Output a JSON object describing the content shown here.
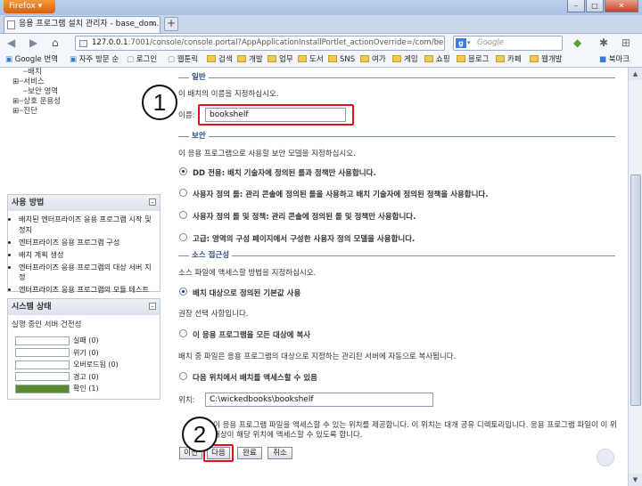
{
  "browser": {
    "app_button": "Firefox",
    "tab_title": "응용 프로그램 설치 관리자 - base_dom...",
    "tab_close": "×",
    "new_tab": "+",
    "url_prefix": "127.0.0.1",
    "url_rest": ":7001/console/console.portal?AppApplicationInstallPortlet_actionOverride=/com/bea",
    "search_placeholder": "Google",
    "window_buttons": [
      "–",
      "□",
      "✕"
    ]
  },
  "bookmarks": [
    {
      "label": "Google 번역",
      "type": "link"
    },
    {
      "label": "자주 방문 순",
      "type": "link"
    },
    {
      "label": "로그인",
      "type": "link"
    },
    {
      "label": "웹툰릭",
      "type": "link"
    },
    {
      "label": "검색",
      "type": "folder"
    },
    {
      "label": "개발",
      "type": "folder"
    },
    {
      "label": "업무",
      "type": "folder"
    },
    {
      "label": "도서",
      "type": "folder"
    },
    {
      "label": "SNS",
      "type": "folder"
    },
    {
      "label": "여가",
      "type": "folder"
    },
    {
      "label": "게임",
      "type": "folder"
    },
    {
      "label": "쇼핑",
      "type": "folder"
    },
    {
      "label": "블로그",
      "type": "folder"
    },
    {
      "label": "카페",
      "type": "folder"
    },
    {
      "label": "웹개발",
      "type": "folder"
    },
    {
      "label": "북마크",
      "type": "link"
    }
  ],
  "sidebar": {
    "tree": [
      "배치",
      "서비스",
      "보안 영역",
      "상호 운용성",
      "진단"
    ],
    "how_to": {
      "title": "사용 방법",
      "items": [
        "배치된 엔터프라이즈 응용 프로그램 시작 및 정지",
        "엔터프라이즈 응용 프로그램 구성",
        "배치 계획 생성",
        "엔터프라이즈 응용 프로그램의 대상 서버 지정",
        "엔터프라이즈 응용 프로그램의 모듈 테스트"
      ]
    },
    "system_status": {
      "title": "시스템 상태",
      "subtitle": "실행 중인 서버 건전성",
      "rows": [
        {
          "label": "실패 (0)",
          "color": "#ffffff",
          "fill": 0
        },
        {
          "label": "위기 (0)",
          "color": "#ffffff",
          "fill": 0
        },
        {
          "label": "오버로드됨 (0)",
          "color": "#ffffff",
          "fill": 0
        },
        {
          "label": "경고 (0)",
          "color": "#ffffff",
          "fill": 0
        },
        {
          "label": "확인 (1)",
          "color": "#5a8a2a",
          "fill": 1
        }
      ]
    }
  },
  "form": {
    "general_label": "일반",
    "general_desc": "이 배치의 이름을 지정하십시오.",
    "name_label": "이름:",
    "name_value": "bookshelf",
    "security_label": "보안",
    "security_desc": "이 응용 프로그램으로 사용할 보안 모델을 지정하십시오.",
    "security_options": [
      {
        "label": "DD 전용: 배치 기술자에 정의된 롤과 정책만 사용합니다.",
        "selected": true
      },
      {
        "label": "사용자 정의 롤: 관리 콘솔에 정의된 롤을 사용하고 배치 기술자에 정의된 정책을 사용합니다.",
        "selected": false
      },
      {
        "label": "사용자 정의 롤 및 정책: 관리 콘솔에 정의된 롤 및 정책만 사용합니다.",
        "selected": false
      },
      {
        "label": "고급: 영역의 구성 페이지에서 구성한 사용자 정의 모델을 사용합니다.",
        "selected": false
      }
    ],
    "source_label": "소스 접근성",
    "source_desc": "소스 파일에 액세스할 방법을 지정하십시오.",
    "source_opt1": "배치 대상으로 정의된 기본값 사용",
    "source_opt1_selected": true,
    "recommended": "권장 선택 사항입니다.",
    "source_opt2": "이 응용 프로그램을 모든 대상에 복사",
    "source_opt2_desc": "배치 중 파일은 응용 프로그램의 대상으로 지정하는 관리된 서버에 자동으로 복사됩니다.",
    "source_opt3": "다음 위치에서 배치를 액세스할 수 있음",
    "location_label": "위치:",
    "location_value": "C:\\wickedbooks\\bookshelf",
    "footer_line1": "이 응용 프로그램 파일을 액세스할 수 있는 위치를 제공합니다. 이 위치는 대개 공유 디렉토리입니다. 응용 프로그램 파일이 이 위",
    "footer_line2": "대상이 해당 위치에 액세스할 수 있도록 합니다.",
    "buttons": {
      "back": "이전",
      "next": "다음",
      "finish": "완료",
      "cancel": "취소"
    }
  },
  "annotations": {
    "step1": "1",
    "step2": "2",
    "color": "#e0121a"
  }
}
